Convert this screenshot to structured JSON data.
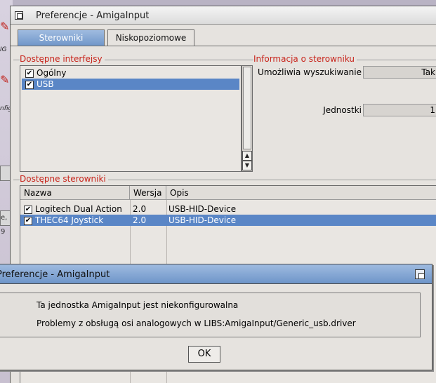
{
  "window": {
    "title": "Preferencje - AmigaInput"
  },
  "tabs": [
    {
      "label": "Sterowniki",
      "active": true
    },
    {
      "label": "Niskopoziomowe",
      "active": false
    }
  ],
  "interfaces": {
    "label": "Dostępne interfejsy",
    "items": [
      {
        "label": "Ogólny",
        "checked": true,
        "selected": false
      },
      {
        "label": "USB",
        "checked": true,
        "selected": true
      }
    ]
  },
  "driver_info": {
    "label": "Informacja o sterowniku",
    "fields": [
      {
        "label": "Umożliwia wyszukiwanie",
        "value": "Tak"
      },
      {
        "label": "Jednostki",
        "value": "1"
      }
    ]
  },
  "drivers": {
    "label": "Dostępne sterowniki",
    "columns": [
      "Nazwa",
      "Wersja",
      "Opis"
    ],
    "rows": [
      {
        "name": "Logitech Dual Action",
        "version": "2.0",
        "description": "USB-HID-Device",
        "checked": true,
        "selected": false
      },
      {
        "name": "THEC64 Joystick",
        "version": "2.0",
        "description": "USB-HID-Device",
        "checked": true,
        "selected": true
      }
    ]
  },
  "dialog": {
    "title": "Preferencje - AmigaInput",
    "message_lines": [
      "Ta jednostka AmigaInput jest niekonfigurowalna",
      "Problemy z obsługą osi analogowych w LIBS:AmigaInput/Generic_usb.driver"
    ],
    "ok_label": "OK"
  },
  "desktop": {
    "fragments": [
      "IG",
      "nfig",
      "e, 9"
    ]
  },
  "colors": {
    "accent": "#5a86c6",
    "group_label": "#c8231a",
    "window_bg": "#e6e3df"
  }
}
